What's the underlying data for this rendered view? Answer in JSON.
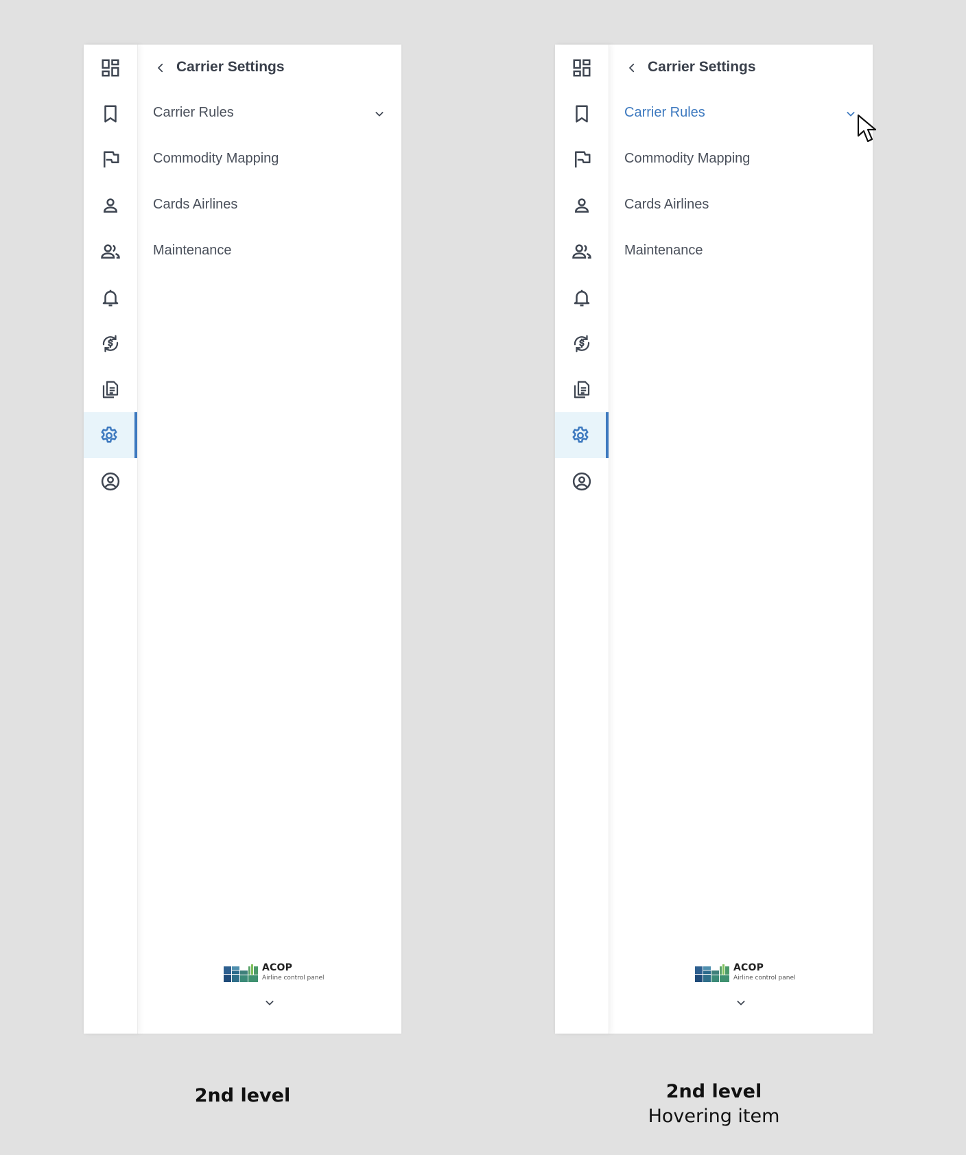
{
  "panels": [
    {
      "state": "default",
      "menu": {
        "title": "Carrier Settings",
        "items": [
          {
            "label": "Carrier Rules",
            "expandable": true
          },
          {
            "label": "Commodity Mapping"
          },
          {
            "label": "Cards Airlines"
          },
          {
            "label": "Maintenance"
          }
        ]
      },
      "logo": {
        "name": "ACOP",
        "subtitle": "Airline control panel"
      },
      "caption": {
        "title": "2nd level",
        "subtitle": ""
      }
    },
    {
      "state": "hovering",
      "menu": {
        "title": "Carrier Settings",
        "items": [
          {
            "label": "Carrier Rules",
            "expandable": true,
            "hovered": true
          },
          {
            "label": "Commodity Mapping"
          },
          {
            "label": "Cards Airlines"
          },
          {
            "label": "Maintenance"
          }
        ]
      },
      "logo": {
        "name": "ACOP",
        "subtitle": "Airline control panel"
      },
      "caption": {
        "title": "2nd level",
        "subtitle": "Hovering item"
      }
    }
  ],
  "rail_icons": [
    "dashboard-icon",
    "bookmark-icon",
    "flag-icon",
    "person-icon",
    "people-icon",
    "bell-icon",
    "currency-exchange-icon",
    "document-icon",
    "gear-icon",
    "account-circle-icon"
  ],
  "active_rail_index": 8,
  "colors": {
    "background": "#e1e1e1",
    "accent": "#3d79bf",
    "active_bg": "#e8f4fa",
    "icon": "#3f4652",
    "text": "#4a505b"
  }
}
